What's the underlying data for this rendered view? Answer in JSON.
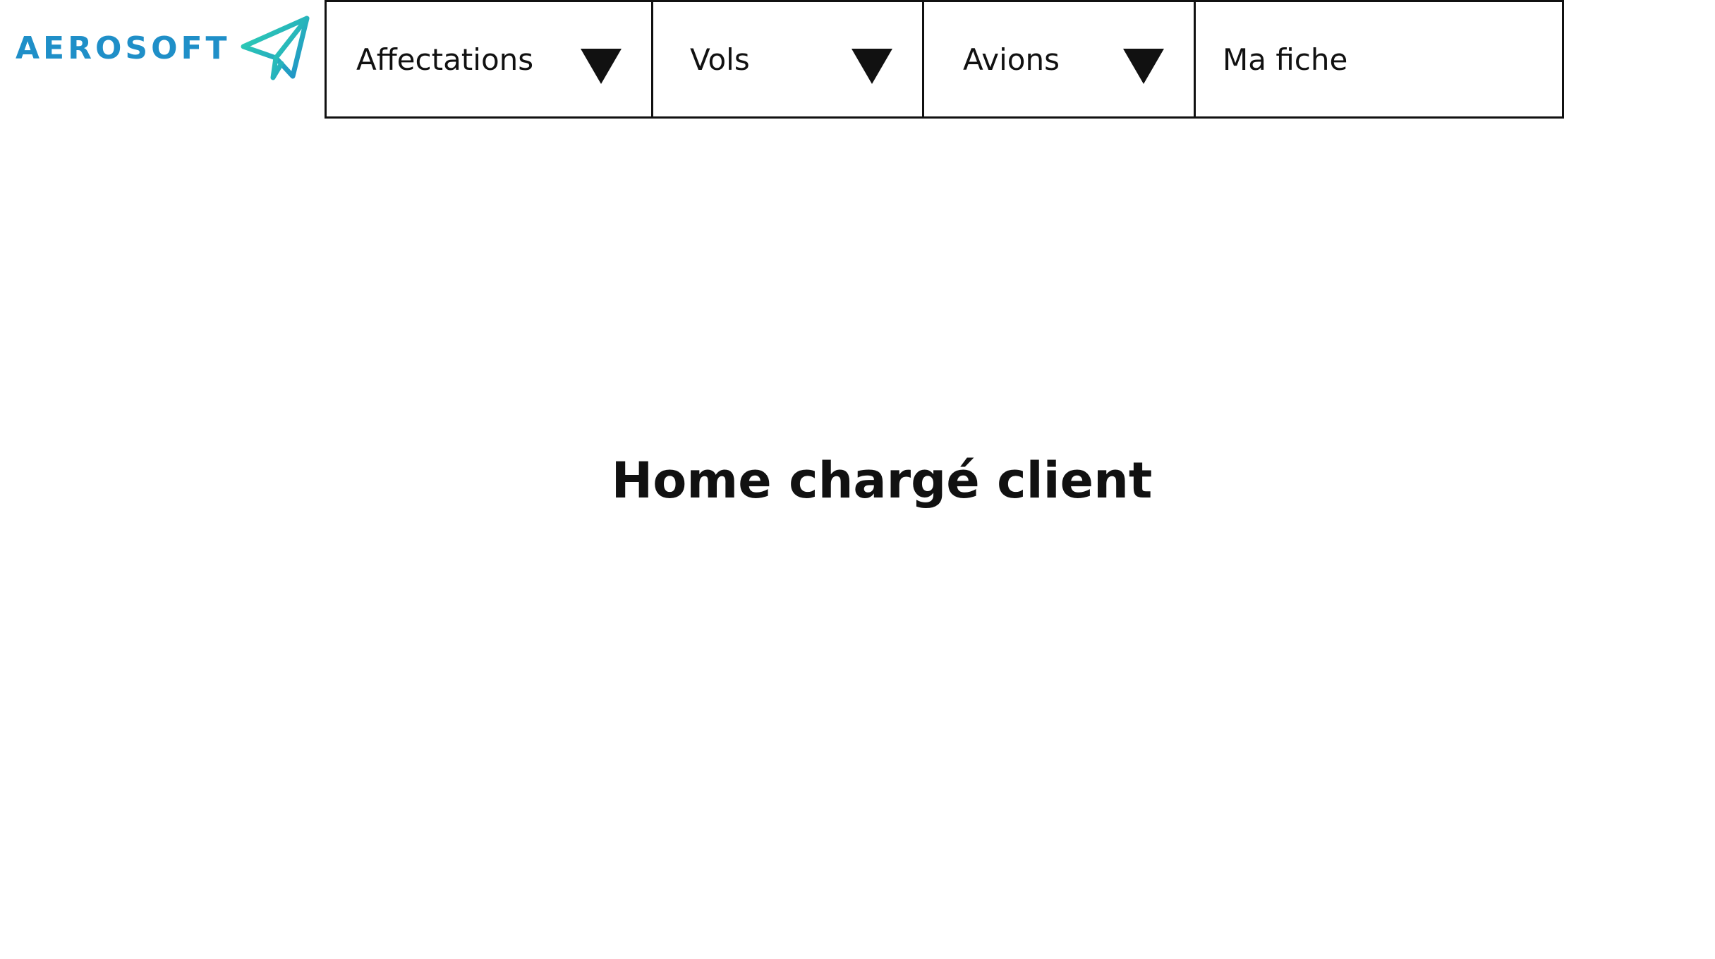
{
  "brand": {
    "name": "AEROSOFT",
    "icon": "paper-plane-icon",
    "color": "#1f8fc8",
    "accent": "#2fd8b0"
  },
  "nav": {
    "items": [
      {
        "label": "Affectations",
        "has_dropdown": true,
        "icon": "triangle-down-icon"
      },
      {
        "label": "Vols",
        "has_dropdown": true,
        "icon": "triangle-down-icon"
      },
      {
        "label": "Avions",
        "has_dropdown": true,
        "icon": "triangle-down-icon"
      },
      {
        "label": "Ma fiche",
        "has_dropdown": false
      }
    ]
  },
  "main": {
    "title": "Home chargé client"
  }
}
